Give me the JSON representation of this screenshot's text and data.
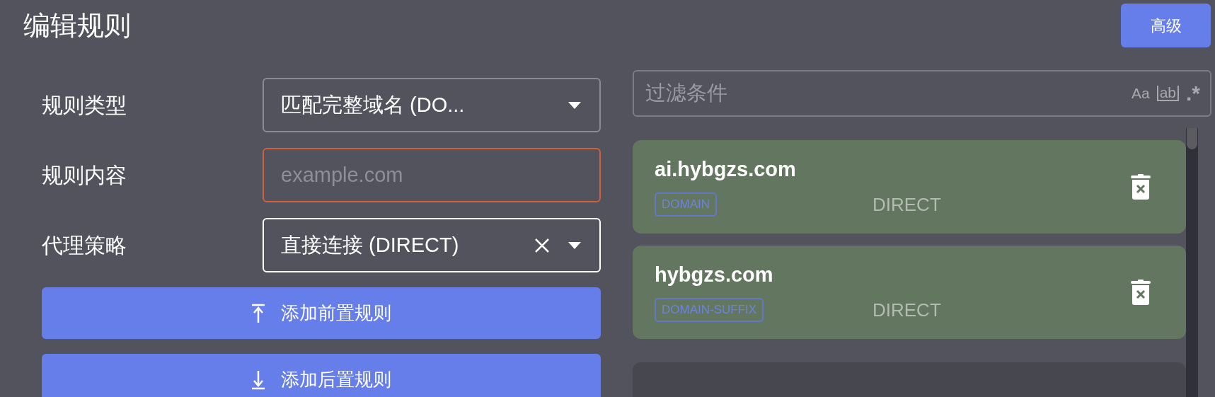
{
  "title": "编辑规则",
  "advanced_button": "高级",
  "form": {
    "fields": [
      {
        "kind": "select",
        "label": "规则类型",
        "value": "匹配完整域名 (DO...",
        "error": false,
        "focused": false,
        "clearable": false
      },
      {
        "kind": "input",
        "label": "规则内容",
        "placeholder": "example.com",
        "error": true,
        "focused": false
      },
      {
        "kind": "select",
        "label": "代理策略",
        "value": "直接连接 (DIRECT)",
        "error": false,
        "focused": true,
        "clearable": true
      }
    ],
    "buttons": [
      {
        "kind": "prepend",
        "label": "添加前置规则"
      },
      {
        "kind": "append",
        "label": "添加后置规则"
      }
    ]
  },
  "filter": {
    "placeholder": "过滤条件",
    "toggles": [
      {
        "kind": "case",
        "label": "Aa"
      },
      {
        "kind": "word",
        "label": "ab"
      },
      {
        "kind": "regex",
        "label": ".*"
      }
    ]
  },
  "rules": [
    {
      "kind": "rule",
      "content": "ai.hybgzs.com",
      "type": "DOMAIN",
      "policy": "DIRECT"
    },
    {
      "kind": "rule",
      "content": "hybgzs.com",
      "type": "DOMAIN-SUFFIX",
      "policy": "DIRECT"
    },
    {
      "kind": "cut"
    }
  ]
}
